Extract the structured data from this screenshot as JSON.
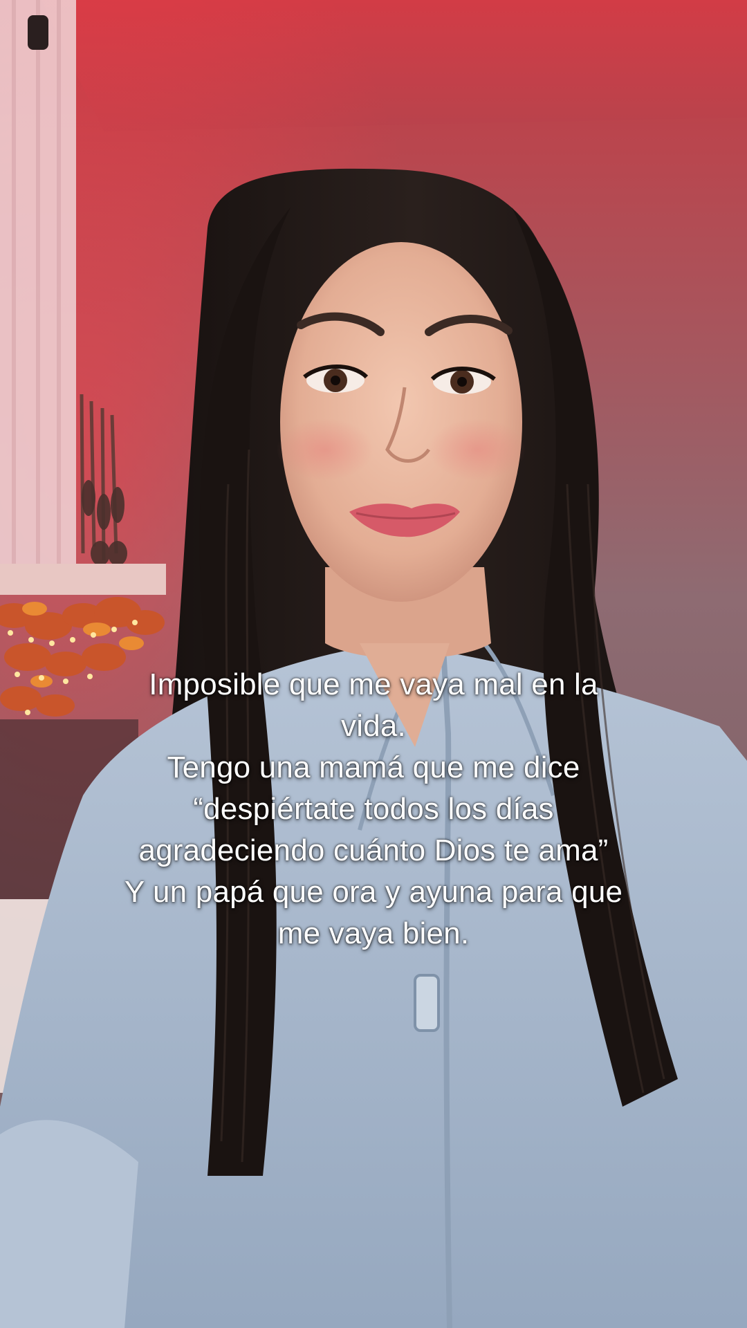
{
  "caption": {
    "lines": [
      "Imposible que me vaya mal en la",
      "vida.",
      "Tengo una mamá que me dice",
      "“despiértate todos los días",
      "agradeciendo cuánto Dios te ama”",
      "Y un papá que ora y ayuna para que",
      "me vaya bien."
    ]
  },
  "scene": {
    "wall_top_color": "#c8404a",
    "wall_color": "#8a6a70",
    "hair_color": "#1c1614",
    "skin_color": "#e8b8a0",
    "jacket_color": "#a8b8cc",
    "lips_color": "#d65a68"
  }
}
